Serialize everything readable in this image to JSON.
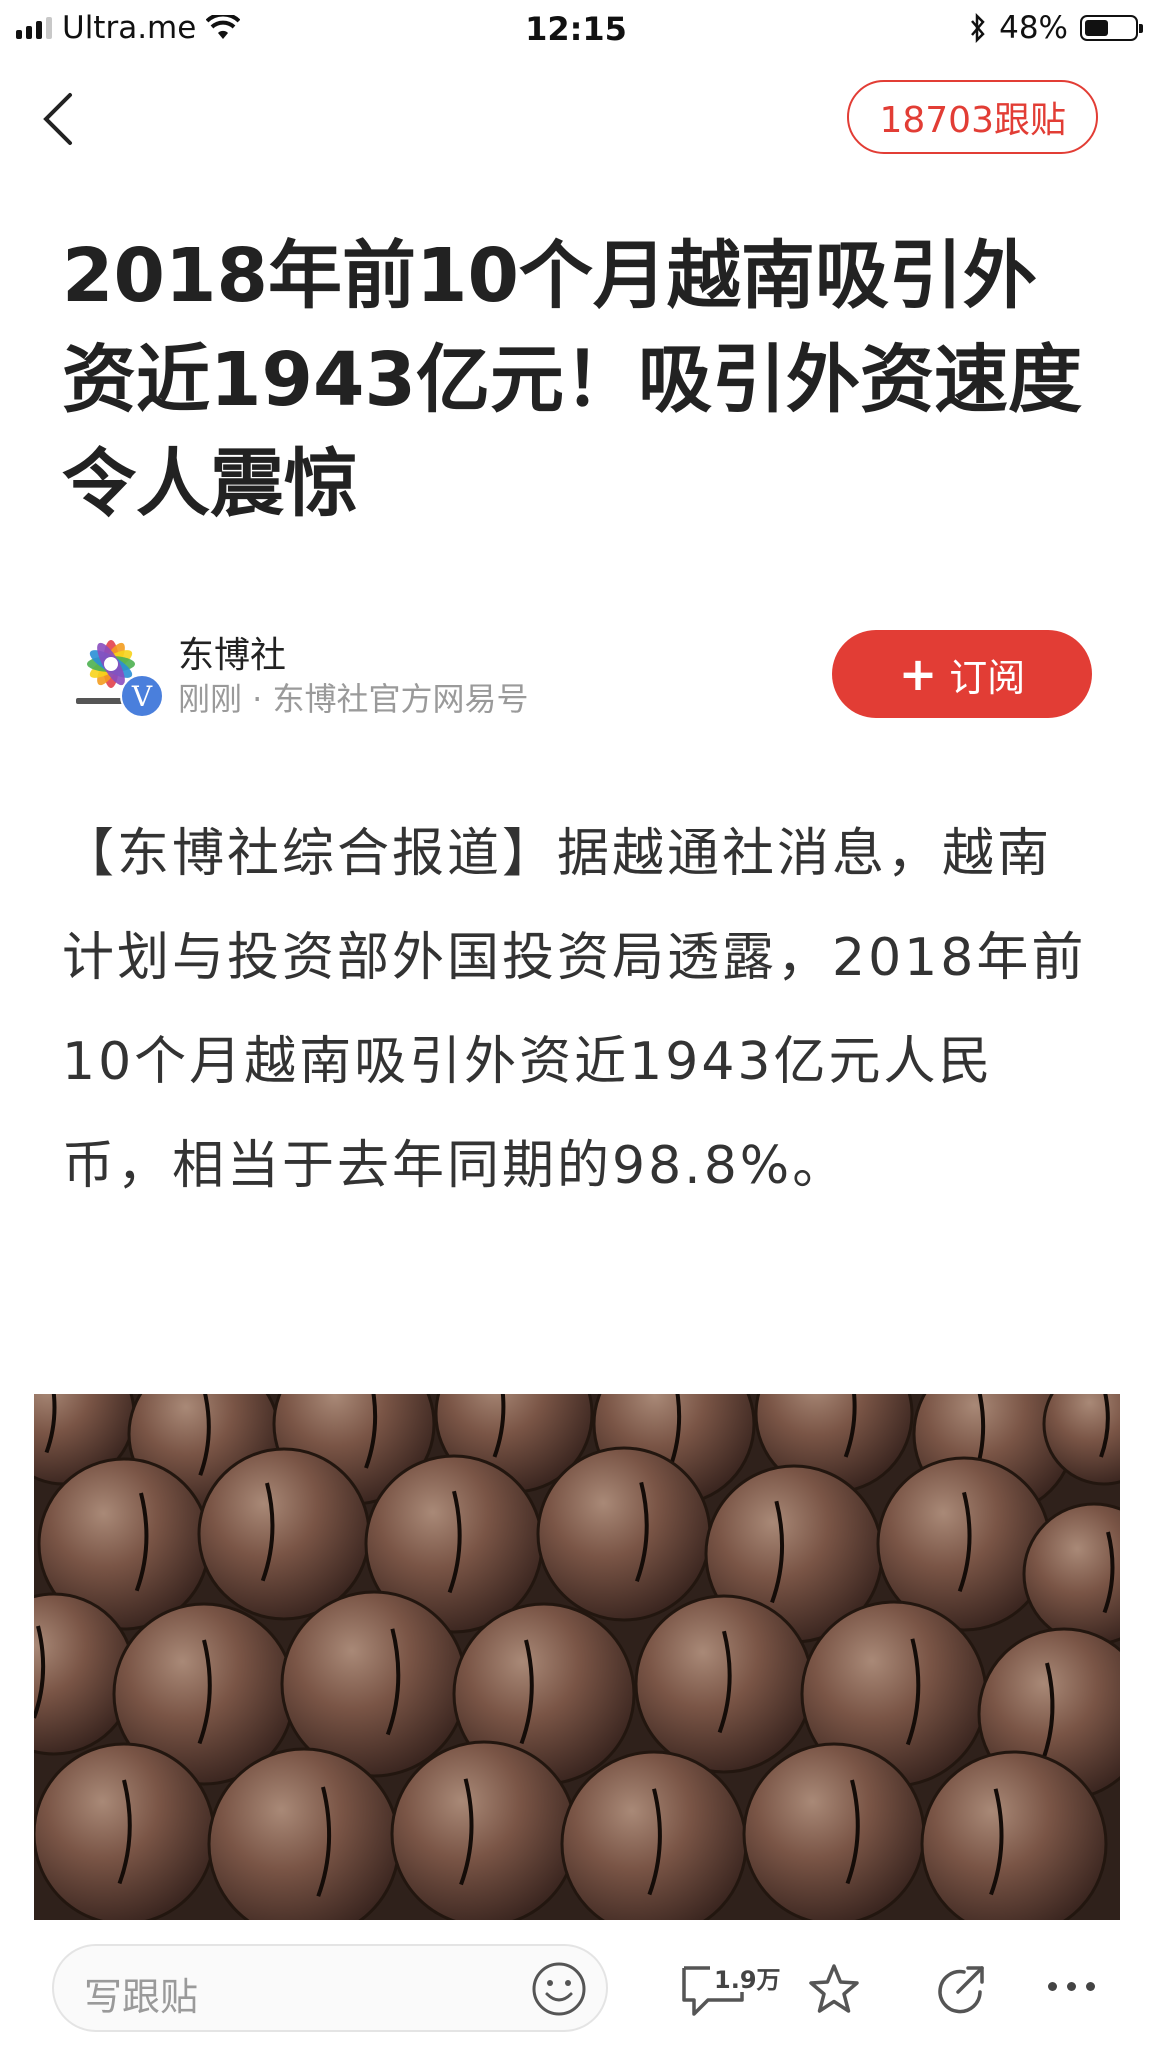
{
  "status_bar": {
    "carrier": "Ultra.me",
    "time": "12:15",
    "battery_percent": "48%",
    "battery_level": 0.48,
    "icons": [
      "signal-icon",
      "wifi-icon",
      "bluetooth-icon",
      "battery-icon"
    ]
  },
  "nav": {
    "back_icon": "chevron-left-icon",
    "reply_count_label": "18703跟贴"
  },
  "article": {
    "title": "2018年前10个月越南吸引外资近1943亿元！吸引外资速度令人震惊",
    "author": {
      "name": "东博社",
      "meta": "刚刚 · 东博社官方网易号",
      "verified_badge": "V"
    },
    "subscribe_label": "订阅",
    "body": "【东博社综合报道】据越通社消息，越南计划与投资部外国投资局透露，2018年前10个月越南吸引外资近1943亿元人民币，相当于去年同期的98.8%。"
  },
  "toolbar": {
    "comment_placeholder": "写跟贴",
    "comment_count": "1.9万",
    "icons": [
      "emoji-icon",
      "comment-icon",
      "star-icon",
      "share-icon",
      "more-icon"
    ]
  },
  "colors": {
    "accent": "#e23d35",
    "verified": "#4a7fdc",
    "meta_text": "#9a9a9a"
  }
}
